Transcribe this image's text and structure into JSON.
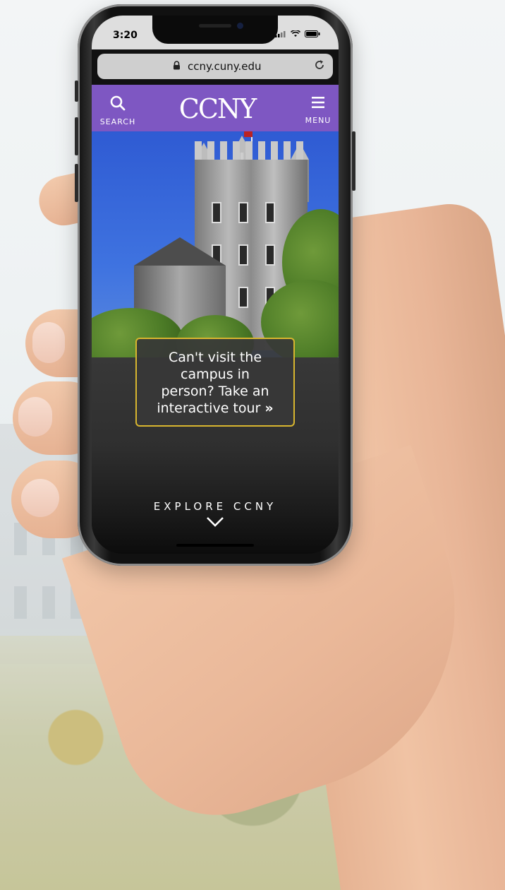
{
  "status_bar": {
    "time": "3:20",
    "icons": "signal-icon wifi-icon battery-icon"
  },
  "browser": {
    "url": "ccny.cuny.edu",
    "lock_icon": "lock-icon",
    "reload_icon": "reload-icon"
  },
  "header": {
    "search_label": "SEARCH",
    "logo": "CCNY",
    "menu_label": "MENU",
    "bg_color": "#7e57c2"
  },
  "hero": {
    "tour_text_1": "Can't visit the",
    "tour_text_2": "campus in",
    "tour_text_3": "person? Take an",
    "tour_text_4": "interactive tour",
    "tour_chevron": "»",
    "border_color": "#d8b62f"
  },
  "explore": {
    "label": "EXPLORE CCNY",
    "arrow_icon": "chevron-down-icon"
  }
}
